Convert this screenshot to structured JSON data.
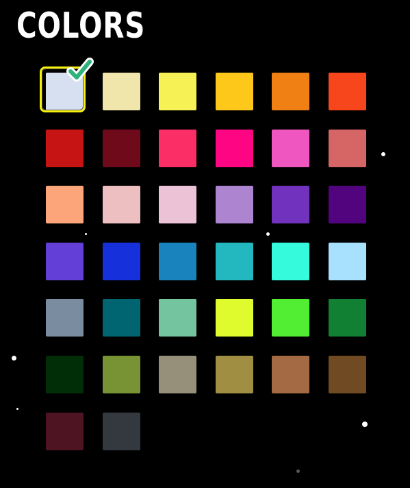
{
  "title": "COLORS",
  "selected_color": "#d6e0f1",
  "colors": [
    "#d6e0f1",
    "#f0e5aa",
    "#f6f256",
    "#fdc81a",
    "#f07f14",
    "#f7461b",
    "#c61414",
    "#6e0a19",
    "#fc2e66",
    "#fe0683",
    "#f056c0",
    "#d66666",
    "#fda57a",
    "#eebfc0",
    "#ecc3d6",
    "#ad84cf",
    "#7133be",
    "#52037e",
    "#633ed7",
    "#1631dc",
    "#1883bc",
    "#23b8c0",
    "#35fbdc",
    "#a8e1fd",
    "#7a8ca0",
    "#006570",
    "#74c49f",
    "#e0fb2d",
    "#52ee33",
    "#128032",
    "#012e07",
    "#779333",
    "#96907a",
    "#a08e42",
    "#a46a43",
    "#6f4a22",
    "#4f1421",
    "#34393f"
  ]
}
